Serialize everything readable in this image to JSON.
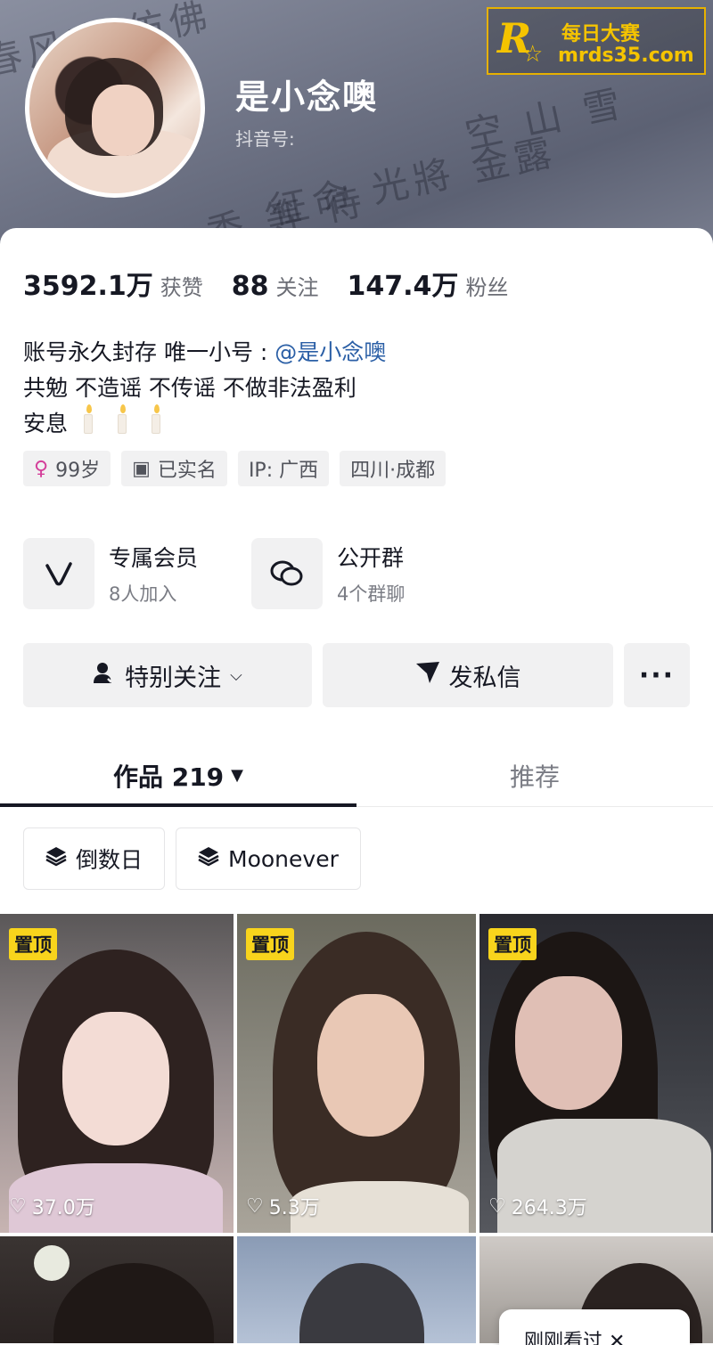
{
  "profile": {
    "username": "是小念噢",
    "douyin_id_label": "抖音号:"
  },
  "watermark": {
    "logo_letter": "R",
    "line1": "每日大赛",
    "line2": "mrds35.com"
  },
  "stats": [
    {
      "value": "3592.1万",
      "label": "获赞"
    },
    {
      "value": "88",
      "label": "关注"
    },
    {
      "value": "147.4万",
      "label": "粉丝"
    }
  ],
  "bio": {
    "line1_text": "账号永久封存 唯一小号 :",
    "line1_mention": "@是小念噢",
    "line2": "共勉 不造谣 不传谣 不做非法盈利",
    "line3": "安息"
  },
  "tags": [
    {
      "icon": "female-icon",
      "label": "99岁"
    },
    {
      "icon": "id-card-icon",
      "label": "已实名"
    },
    {
      "icon": "",
      "label": "IP: 广西"
    },
    {
      "icon": "",
      "label": "四川·成都"
    }
  ],
  "services": [
    {
      "icon": "v-icon",
      "title": "专属会员",
      "subtitle": "8人加入"
    },
    {
      "icon": "chat-bubbles-icon",
      "title": "公开群",
      "subtitle": "4个群聊"
    }
  ],
  "actions": {
    "follow_label": "特别关注",
    "message_label": "发私信",
    "more_label": "···"
  },
  "tabs": {
    "works_label": "作品 219",
    "recommend_label": "推荐"
  },
  "collections": [
    {
      "icon": "layers-icon",
      "label": "倒数日"
    },
    {
      "icon": "layers-icon",
      "label": "Moonever"
    }
  ],
  "videos": [
    {
      "pinned": true,
      "pin_label": "置顶",
      "likes": "37.0万"
    },
    {
      "pinned": true,
      "pin_label": "置顶",
      "likes": "5.3万"
    },
    {
      "pinned": true,
      "pin_label": "置顶",
      "likes": "264.3万"
    },
    {
      "pinned": false,
      "pin_label": "",
      "likes": ""
    },
    {
      "pinned": false,
      "pin_label": "",
      "likes": ""
    },
    {
      "pinned": false,
      "pin_label": "",
      "likes": ""
    }
  ],
  "toast": {
    "label": "刚刚看过 ✕"
  },
  "colors": {
    "mention": "#2b5fa6",
    "pin_badge": "#f8d41c",
    "watermark": "#f5c400"
  }
}
